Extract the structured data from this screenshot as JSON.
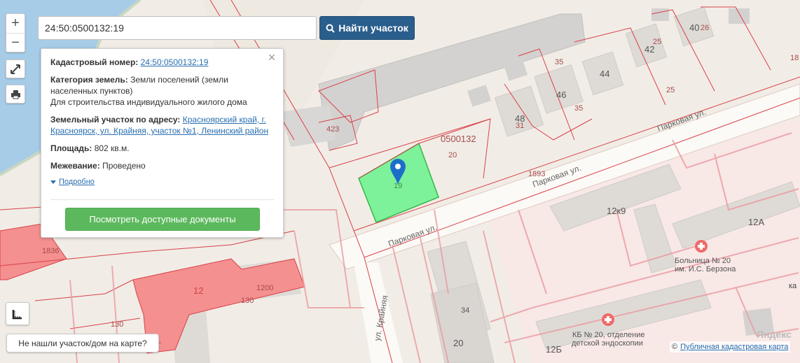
{
  "search": {
    "value": "24:50:0500132:19",
    "button_label": "Найти участок"
  },
  "controls": {
    "zoom_in": "+",
    "zoom_out": "−"
  },
  "info_card": {
    "cadastral_label": "Кадастровый номер:",
    "cadastral_value": "24:50:0500132:19",
    "category_label": "Категория земель:",
    "category_value": "Земли поселений (земли населенных пунктов)",
    "purpose_value": "Для строительства индивидуального жилого дома",
    "address_label": "Земельный участок по адресу:",
    "address_value": "Красноярский край, г. Красноярск, ул. Крайняя, участок №1, Ленинский район",
    "area_label": "Площадь:",
    "area_value": "802 кв.м.",
    "survey_label": "Межевание:",
    "survey_value": "Проведено",
    "more_label": "Подробно",
    "docs_button": "Посмотреть доступные документы",
    "close": "×"
  },
  "not_found_button": "Не нашли участок/дом на карте?",
  "attribution": {
    "copyright": "©",
    "link": "Публичная кадастровая карта"
  },
  "yandex_logo": "Яндекс",
  "right_edge_fragment": "ка",
  "map_labels": {
    "quarter": "0500132",
    "parcel_20": "20",
    "parcel_19": "19",
    "n423": "423",
    "n1836": "1836",
    "n12": "12",
    "n1200": "1200",
    "n130a": "130",
    "n130b": "130",
    "n48": "48",
    "n31": "31",
    "n46": "46",
    "n35a": "35",
    "n35b": "35",
    "n44": "44",
    "n42": "42",
    "n25a": "25",
    "n25b": "25",
    "n40": "40",
    "n26": "26",
    "n18": "18",
    "n1893": "1893",
    "street1": "Парковая ул.",
    "street2": "Парковая ул.",
    "street3": "Парковая ул.",
    "street4": "ул. Крайняя",
    "b12k9": "12к9",
    "b12a": "12А",
    "hospital": "Больница № 20",
    "hospital2": "им. И.С. Берзона",
    "kb": "КБ № 20, отделение",
    "kb2": "детской эндоскопии",
    "b34": "34",
    "b20": "20",
    "b12b": "12Б"
  },
  "colors": {
    "search_button": "#2a5e8c",
    "docs_button": "#5cb85c",
    "parcel_fill": "#7df29a",
    "cadastre_line": "#d9404a",
    "red_parcel": "#f4908f",
    "water": "#a6cce8"
  },
  "icons": [
    "search-icon",
    "zoom-in-icon",
    "zoom-out-icon",
    "fullscreen-icon",
    "print-icon",
    "ruler-icon",
    "map-pin-icon",
    "hospital-icon",
    "close-icon"
  ]
}
